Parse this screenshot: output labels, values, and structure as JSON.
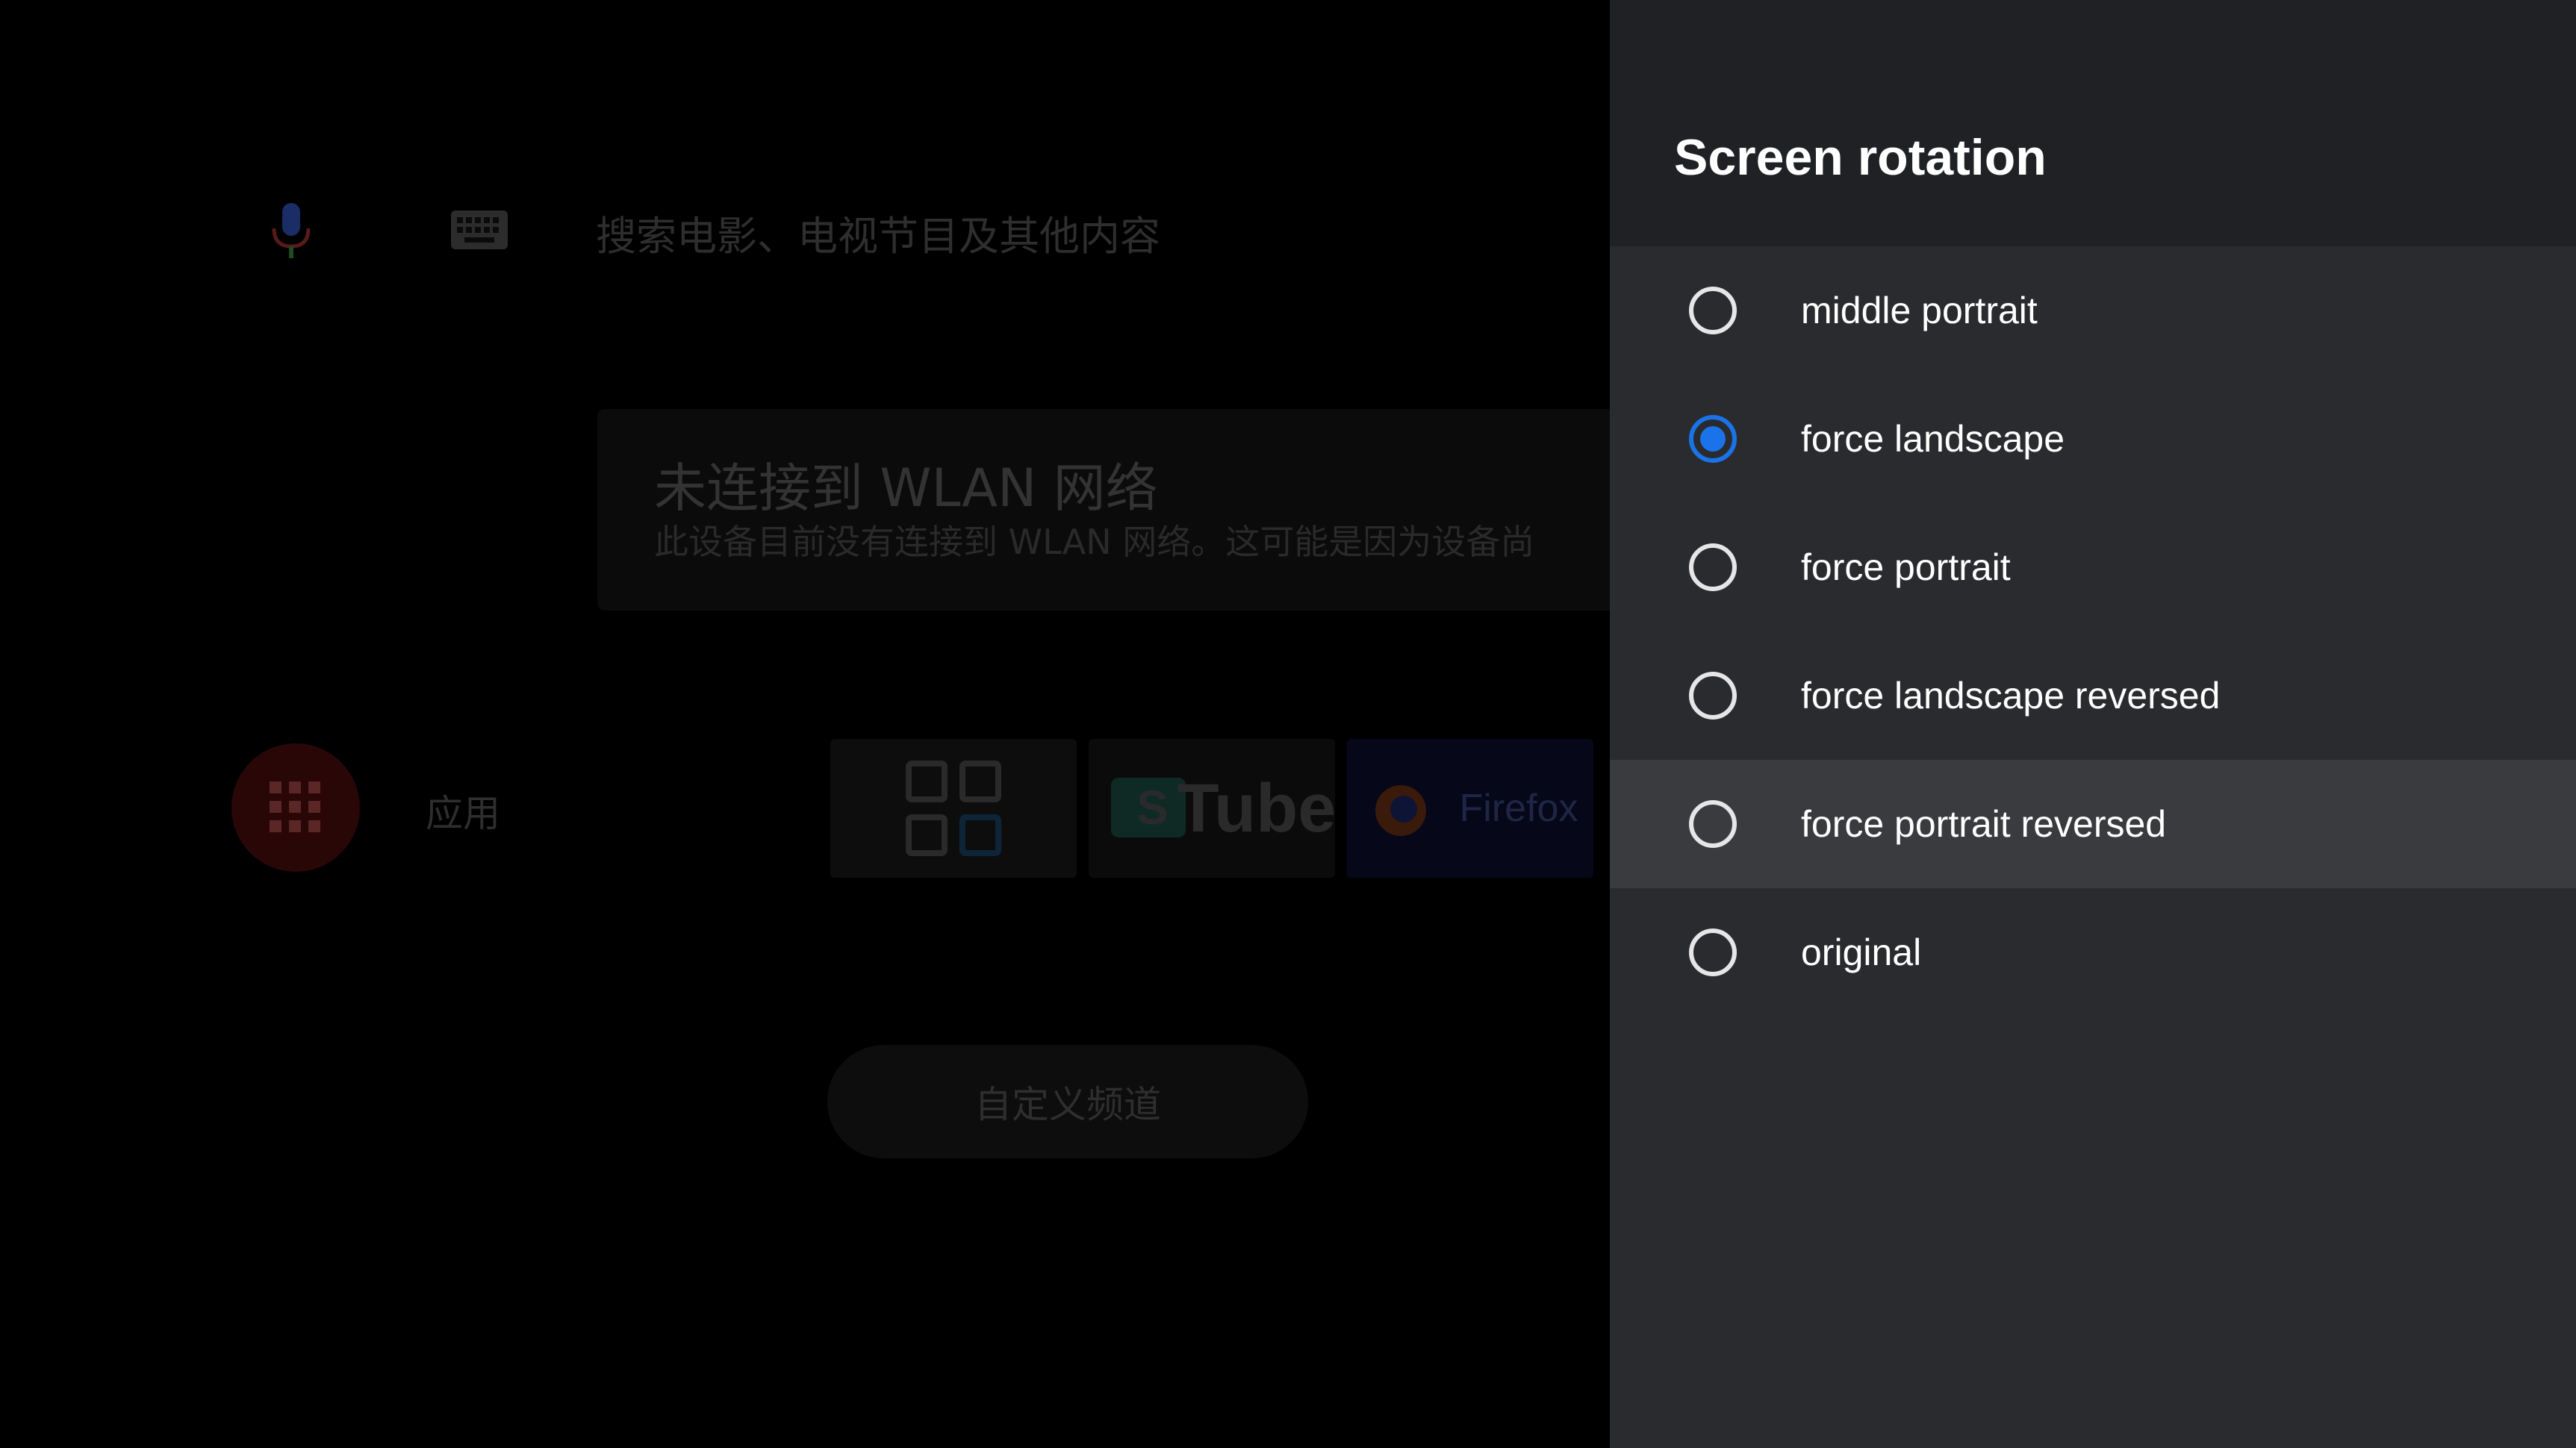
{
  "launcher": {
    "search_placeholder": "搜索电影、电视节目及其他内容",
    "wlan_title": "未连接到 WLAN 网络",
    "wlan_description": "此设备目前没有连接到 WLAN 网络。这可能是因为设备尚",
    "apps_label": "应用",
    "tiles": [
      {
        "name": "apps-grid-tile",
        "label": ""
      },
      {
        "name": "youtube-tile",
        "label": "Tube"
      },
      {
        "name": "firefox-tile",
        "label": "Firefox"
      }
    ],
    "channel_button": "自定义频道"
  },
  "panel": {
    "title": "Screen rotation",
    "options": [
      {
        "label": "middle portrait",
        "checked": false
      },
      {
        "label": "force landscape",
        "checked": true
      },
      {
        "label": "force portrait",
        "checked": false
      },
      {
        "label": "force landscape reversed",
        "checked": false
      },
      {
        "label": "force portrait reversed",
        "checked": false,
        "focused": true
      },
      {
        "label": "original",
        "checked": false
      }
    ]
  },
  "colors": {
    "accent": "#1a73e8",
    "panel_bg": "#202124",
    "list_bg": "#2a2b2e",
    "focus_bg": "#3a3b3e"
  }
}
